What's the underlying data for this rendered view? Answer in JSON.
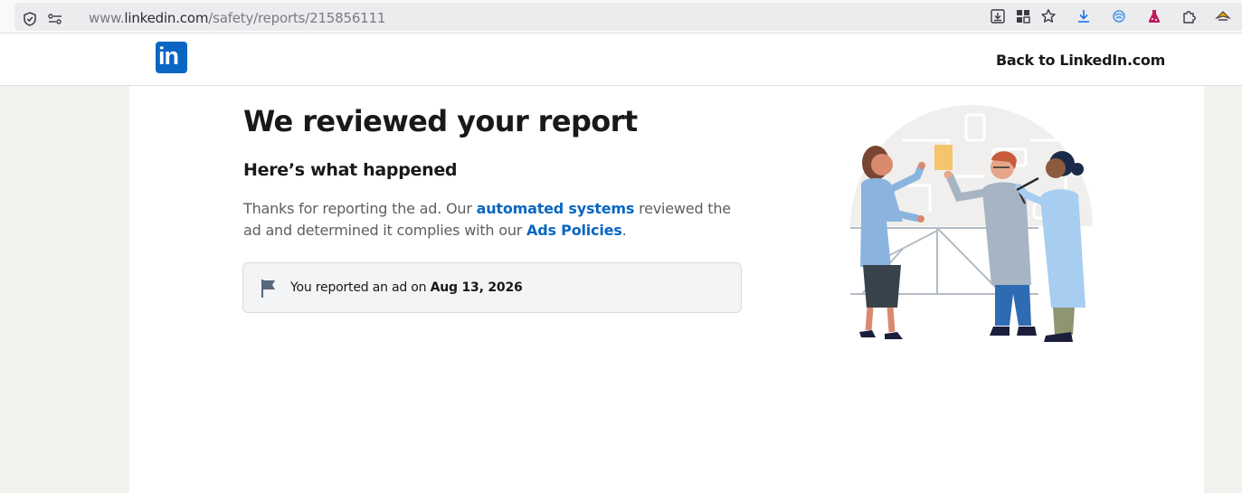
{
  "browser": {
    "url_prefix": "www.",
    "url_host": "linkedin.com",
    "url_path": "/safety/reports/215856111",
    "icons": [
      "shield-icon",
      "site-permissions-icon",
      "page-save-icon",
      "extensions-grid-icon",
      "bookmark-star-icon",
      "downloads-icon",
      "extension-icon",
      "extension-icon",
      "puzzle-icon",
      "extension-icon"
    ]
  },
  "header": {
    "logo_text": "in",
    "back_link": "Back to LinkedIn.com"
  },
  "report": {
    "title": "We reviewed your report",
    "subtitle": "Here’s what happened",
    "body_part1": "Thanks for reporting the ad. Our ",
    "link_automated": "automated systems",
    "body_part2": " reviewed the ad and determined it complies with our ",
    "link_policies": "Ads Policies",
    "body_part3": ".",
    "notice_prefix": "You reported an ad on ",
    "notice_date": "Aug 13, 2026"
  },
  "colors": {
    "brand": "#0a66c2",
    "page_bg": "#f3f2ef",
    "text": "#191919",
    "muted_text": "#5e5e5e"
  }
}
